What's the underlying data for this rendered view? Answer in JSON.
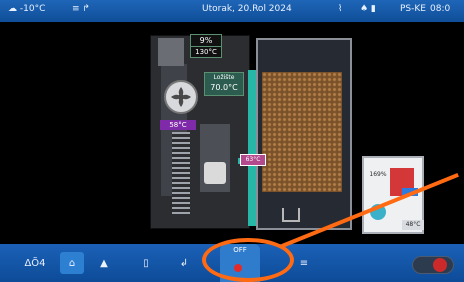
{
  "topbar": {
    "outdoor_temp": "-10°C",
    "date": "Utorak, 20.Rol 2024",
    "network_label": "PS-KE",
    "time": "08:0"
  },
  "scene": {
    "percent": "9%",
    "temp_small": "130°C",
    "temp_main_label": "Ložište",
    "temp_main_value": "70.0°C",
    "purple_tag": "58°C",
    "pink_tag": "63°C",
    "mix_top": "169%",
    "mix_bottom": "48°C"
  },
  "bottombar": {
    "left_item_1": "ΔÕ4",
    "left_item_2": "⌂",
    "left_item_3": "▲",
    "left_item_4": "▯",
    "left_item_5": "↲",
    "center_status": "OFF",
    "center_icon": "stop",
    "list_icon": "≡"
  },
  "colors": {
    "accent_blue": "#1f66b8",
    "teal_pipe": "#26b7a7",
    "annotation_orange": "#ff6a12",
    "alert_red": "#e52929"
  }
}
